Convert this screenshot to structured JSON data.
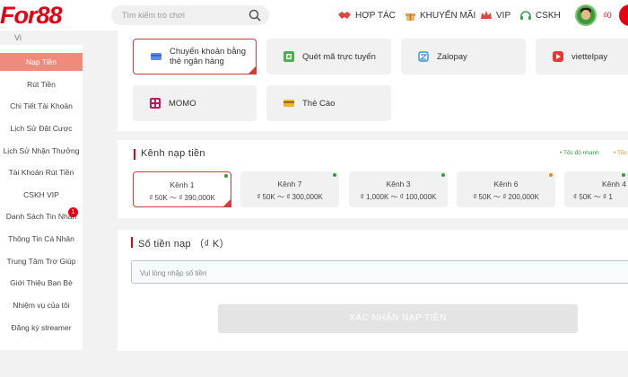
{
  "header": {
    "logo_text": "For88",
    "logo_sub": "Vi",
    "search_placeholder": "Tìm kiếm trò chơi",
    "nav": [
      "HỢP TÁC",
      "KHUYẾN MÃI",
      "VIP",
      "CSKH"
    ],
    "right_text": "₫0"
  },
  "sidebar": {
    "items": [
      "Nạp Tiền",
      "Rút Tiền",
      "Chi Tiết Tài Khoản",
      "Lịch Sử Đặt Cược",
      "Lịch Sử Nhận Thưởng",
      "Tài Khoản Rút Tiền",
      "CSKH VIP",
      "Danh Sách Tin Nhắn",
      "Thông Tin Cá Nhân",
      "Trung Tâm Trợ Giúp",
      "Giới Thiệu Bạn Bè",
      "Nhiệm vụ của tôi",
      "Đăng ký streamer"
    ],
    "active_index": 0,
    "messages_badge": "1"
  },
  "payment_methods": [
    "Chuyển khoản bằng thẻ ngân hàng",
    "Quét mã trực tuyến",
    "Zalopay",
    "viettelpay",
    "MOMO",
    "Thẻ Cào"
  ],
  "channels": {
    "title": "Kênh nạp tiền",
    "legend_fast": "• Tốc độ nhanh",
    "legend_other": "• Tốc",
    "items": [
      {
        "name": "Kênh 1",
        "range": "₫ 50K ～ ₫ 390,000K"
      },
      {
        "name": "Kênh 7",
        "range": "₫ 50K ～ ₫ 300,000K"
      },
      {
        "name": "Kênh 3",
        "range": "₫ 1,000K ～ ₫ 100,000K"
      },
      {
        "name": "Kênh 6",
        "range": "₫ 50K ～ ₫ 200,000K"
      },
      {
        "name": "Kênh 4",
        "range": "₫ 50K ～ ₫ 1"
      }
    ]
  },
  "amount": {
    "title": "Số tiền nạp （₫ K）",
    "placeholder": "Vui lòng nhập số tiền"
  },
  "submit_label": "XÁC NHẬN NẠP TIỀN",
  "colors": {
    "accent": "#e60012",
    "active_sidebar": "#f08a7d",
    "dot_green": "#2f9e3b",
    "dot_orange": "#e88a1a"
  }
}
